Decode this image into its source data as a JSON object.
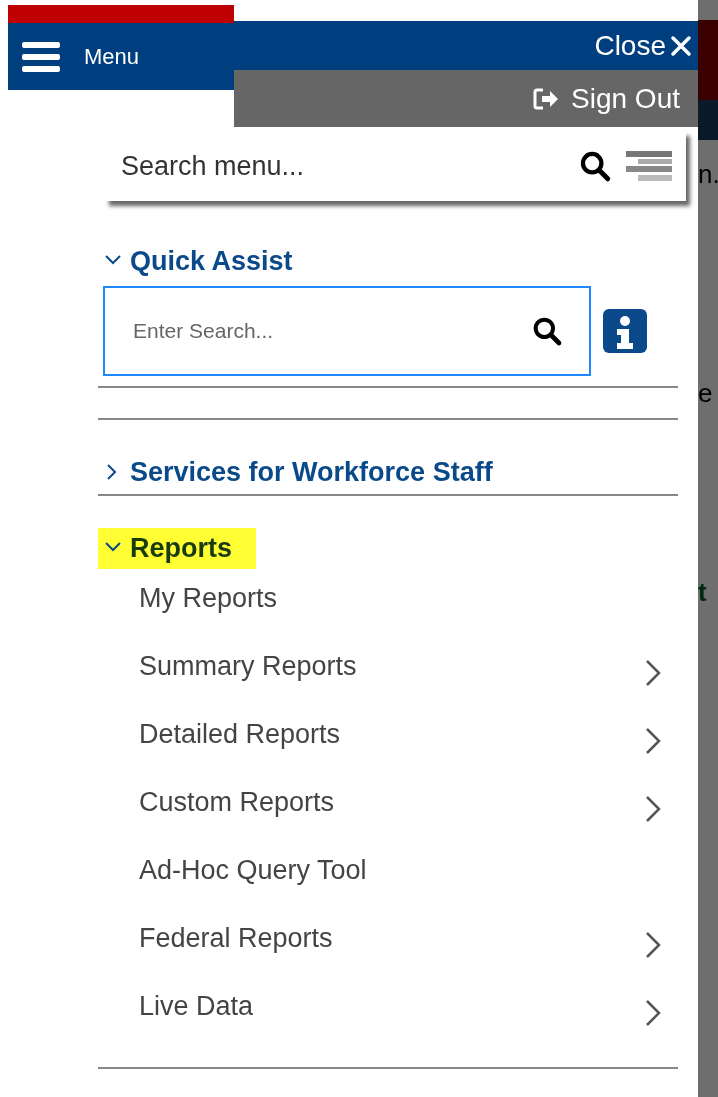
{
  "header": {
    "menu_label": "Menu",
    "close_label": "Close",
    "sign_out_label": "Sign Out"
  },
  "search_menu": {
    "placeholder": "Search menu..."
  },
  "sections": [
    {
      "kind": "search",
      "title": "Quick Assist",
      "expanded": true,
      "highlighted": false,
      "placeholder": "Enter Search..."
    },
    {
      "kind": "list",
      "title": "Services for Workforce Staff",
      "expanded": false,
      "highlighted": false
    },
    {
      "kind": "list",
      "title": "Reports",
      "expanded": true,
      "highlighted": true,
      "items": [
        {
          "label": "My Reports",
          "has_submenu": false
        },
        {
          "label": "Summary Reports",
          "has_submenu": true
        },
        {
          "label": "Detailed Reports",
          "has_submenu": true
        },
        {
          "label": "Custom Reports",
          "has_submenu": true
        },
        {
          "label": "Ad-Hoc Query Tool",
          "has_submenu": false
        },
        {
          "label": "Federal Reports",
          "has_submenu": true
        },
        {
          "label": "Live Data",
          "has_submenu": true
        }
      ]
    }
  ],
  "background_page": {
    "fragments": [
      "n.",
      "e",
      "t"
    ]
  }
}
